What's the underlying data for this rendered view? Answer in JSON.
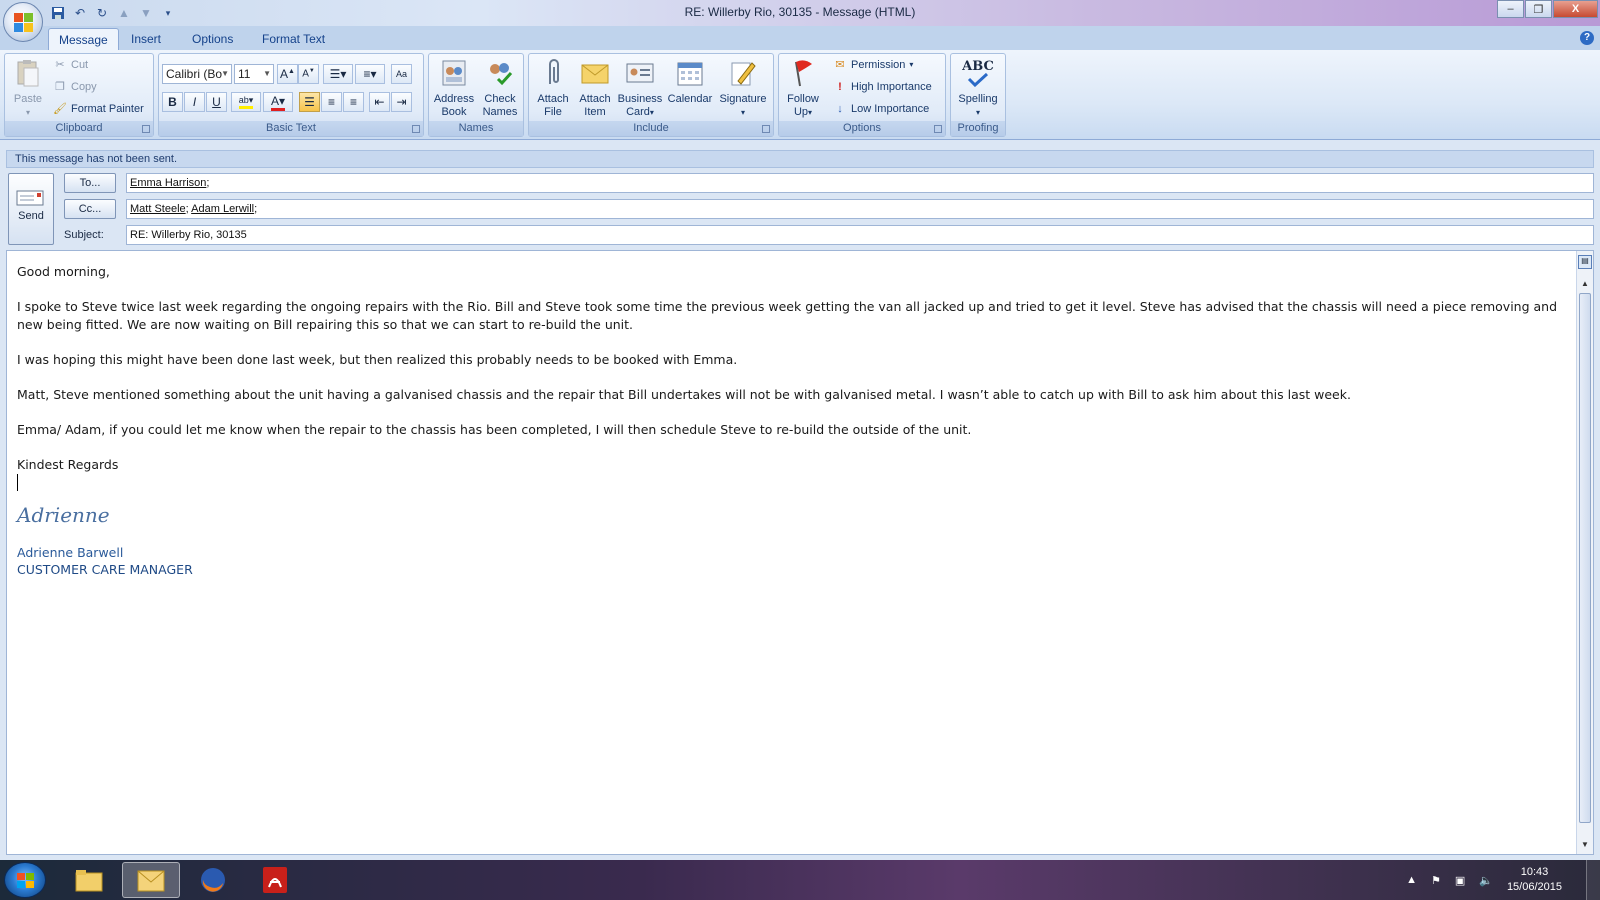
{
  "window": {
    "title": "RE: Willerby Rio, 30135 - Message (HTML)",
    "controls": [
      "–",
      "❐",
      "X"
    ]
  },
  "tabs": [
    "Message",
    "Insert",
    "Options",
    "Format Text"
  ],
  "ribbon": {
    "clipboard": {
      "label": "Clipboard",
      "paste": "Paste",
      "cut": "Cut",
      "copy": "Copy",
      "format_painter": "Format Painter"
    },
    "basic_text": {
      "label": "Basic Text",
      "font": "Calibri (Bo",
      "size": "11"
    },
    "names": {
      "label": "Names",
      "address_book": [
        "Address",
        "Book"
      ],
      "check_names": [
        "Check",
        "Names"
      ]
    },
    "include": {
      "label": "Include",
      "attach_file": [
        "Attach",
        "File"
      ],
      "attach_item": [
        "Attach",
        "Item"
      ],
      "business_card": [
        "Business",
        "Card"
      ],
      "calendar": "Calendar",
      "signature": "Signature"
    },
    "options": {
      "label": "Options",
      "follow_up": [
        "Follow",
        "Up"
      ],
      "permission": "Permission",
      "high_importance": "High Importance",
      "low_importance": "Low Importance"
    },
    "proofing": {
      "label": "Proofing",
      "spelling": "Spelling",
      "abc": "ABC"
    }
  },
  "infobar": "This message has not been sent.",
  "header": {
    "send": "Send",
    "to_button": "To...",
    "cc_button": "Cc...",
    "subject_label": "Subject:",
    "to_recipients": [
      "Emma Harrison"
    ],
    "cc_recipients": [
      "Matt Steele",
      "Adam Lerwill"
    ],
    "subject": "RE: Willerby Rio, 30135"
  },
  "body": {
    "paragraphs": [
      "Good morning,",
      "I spoke to Steve twice last week regarding the ongoing repairs with the Rio.  Bill and Steve took some time the previous week getting the van all jacked up and tried to get it level.  Steve has advised that the chassis will need a piece removing and new being fitted.    We are now waiting on Bill repairing this so that we can start to re-build the unit.",
      "I was hoping this might have been done last week, but then realized this probably needs to be booked with Emma.",
      "Matt, Steve mentioned something about the unit having a galvanised chassis and the repair that Bill undertakes will not be with galvanised metal.  I wasn’t able to catch up with Bill to ask him about this last week.",
      "Emma/ Adam, if you could let me know when the repair to the chassis has been completed, I will then schedule Steve to re-build the outside of the unit."
    ],
    "closing": "Kindest Regards",
    "signature_script": "Adrienne",
    "signature_name": "Adrienne Barwell",
    "signature_title": "CUSTOMER CARE MANAGER"
  },
  "taskbar": {
    "time": "10:43",
    "date": "15/06/2015"
  }
}
